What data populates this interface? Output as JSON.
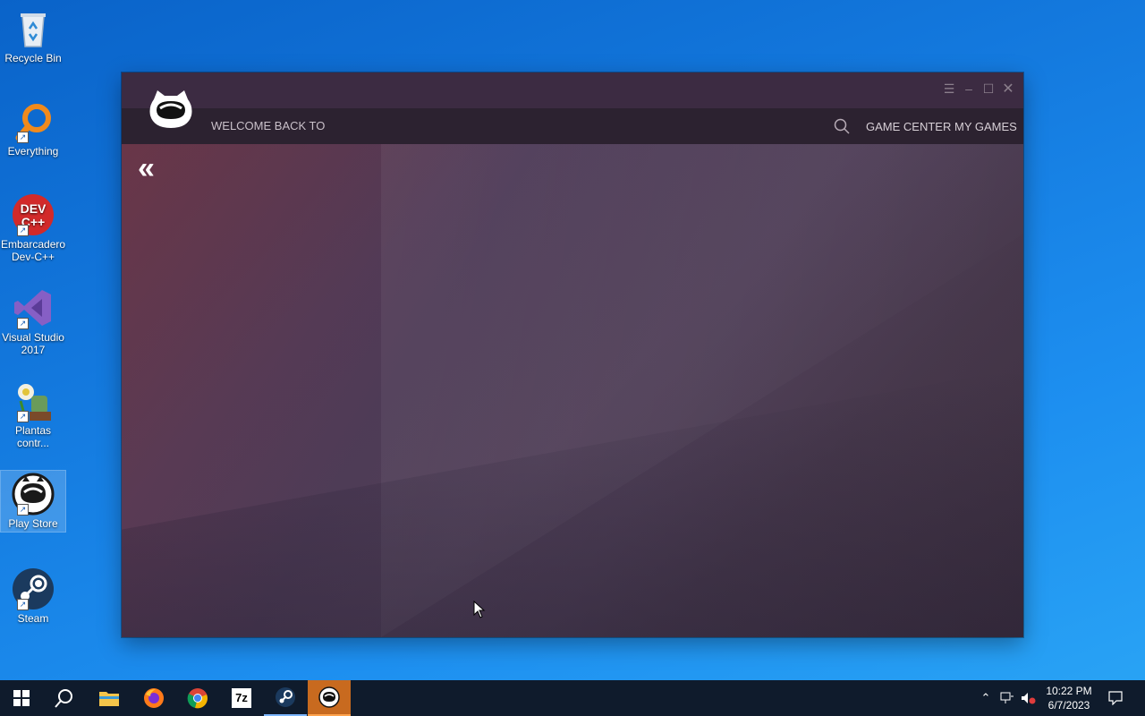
{
  "desktop": {
    "icons": [
      {
        "label": "Recycle Bin",
        "icon": "recycle-bin-icon"
      },
      {
        "label": "Everything",
        "icon": "everything-search-icon"
      },
      {
        "label": "Embarcadero Dev-C++",
        "icon": "devcpp-icon"
      },
      {
        "label": "Visual Studio 2017",
        "icon": "visual-studio-icon"
      },
      {
        "label": "Plantas contr...",
        "icon": "plants-vs-zombies-icon"
      },
      {
        "label": "Play Store",
        "icon": "play-store-icon"
      },
      {
        "label": "Steam",
        "icon": "steam-icon"
      }
    ]
  },
  "app": {
    "welcome_text": "WELCOME BACK TO",
    "nav": {
      "game_center": "GAME CENTER",
      "my_games": "MY GAMES"
    },
    "back_glyph": "«",
    "colors": {
      "titlebar": "#3c2b42",
      "navbar": "#2c2230"
    }
  },
  "taskbar": {
    "items": [
      "start-icon",
      "search-icon",
      "file-explorer-icon",
      "firefox-icon",
      "chrome-icon",
      "7zip-icon",
      "steam-icon",
      "play-store-icon"
    ],
    "sevenzip_label": "7z",
    "clock": {
      "time": "10:22 PM",
      "date": "6/7/2023"
    }
  }
}
